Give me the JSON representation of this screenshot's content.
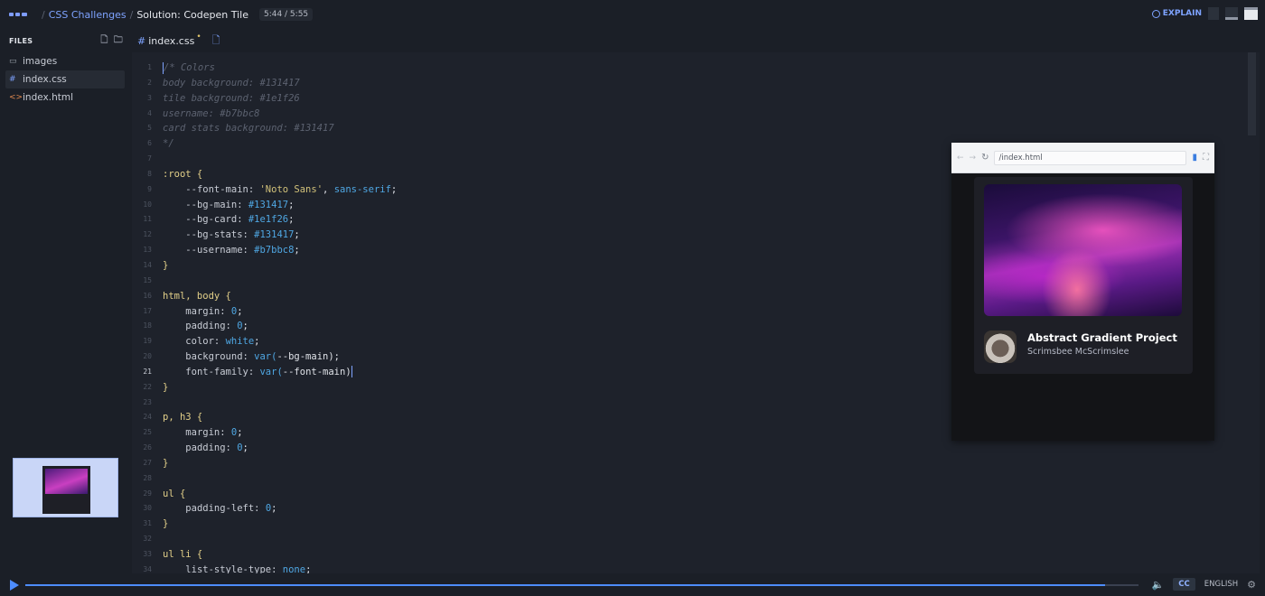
{
  "topbar": {
    "breadcrumb_course": "CSS Challenges",
    "breadcrumb_lesson": "Solution: Codepen Tile",
    "time": "5:44 / 5:55",
    "explain_label": "EXPLAIN"
  },
  "sidebar": {
    "heading": "FILES",
    "items": [
      {
        "label": "images",
        "icon": "folder-icon"
      },
      {
        "label": "index.css",
        "icon": "#"
      },
      {
        "label": "index.html",
        "icon": "<>"
      }
    ]
  },
  "tab": {
    "filename": "index.css",
    "hash": "#",
    "modified": "•"
  },
  "code": {
    "current_line": 21,
    "lines": [
      [
        "/* Colors"
      ],
      [
        "body background: #131417"
      ],
      [
        "tile background: #1e1f26"
      ],
      [
        "username: #b7bbc8"
      ],
      [
        "card stats background: #131417"
      ],
      [
        "*/"
      ],
      [
        ""
      ],
      [
        ":root {"
      ],
      [
        "    --font-main: 'Noto Sans', sans-serif;"
      ],
      [
        "    --bg-main: #131417;"
      ],
      [
        "    --bg-card: #1e1f26;"
      ],
      [
        "    --bg-stats: #131417;"
      ],
      [
        "    --username: #b7bbc8;"
      ],
      [
        "}"
      ],
      [
        ""
      ],
      [
        "html, body {"
      ],
      [
        "    margin: 0;"
      ],
      [
        "    padding: 0;"
      ],
      [
        "    color: white;"
      ],
      [
        "    background: var(--bg-main);"
      ],
      [
        "    font-family: var(--font-main)"
      ],
      [
        "}"
      ],
      [
        ""
      ],
      [
        "p, h3 {"
      ],
      [
        "    margin: 0;"
      ],
      [
        "    padding: 0;"
      ],
      [
        "}"
      ],
      [
        ""
      ],
      [
        "ul {"
      ],
      [
        "    padding-left: 0;"
      ],
      [
        "}"
      ],
      [
        ""
      ],
      [
        "ul li {"
      ],
      [
        "    list-style-type: none;"
      ]
    ]
  },
  "preview": {
    "url": "/index.html",
    "card_title": "Abstract Gradient Project",
    "card_username": "Scrimsbee McScrimslee"
  },
  "player": {
    "progress": 0.97,
    "cc_label": "CC",
    "language": "ENGLISH"
  },
  "colors": {
    "accent": "#4d8dff",
    "link": "#7ea3ff"
  }
}
